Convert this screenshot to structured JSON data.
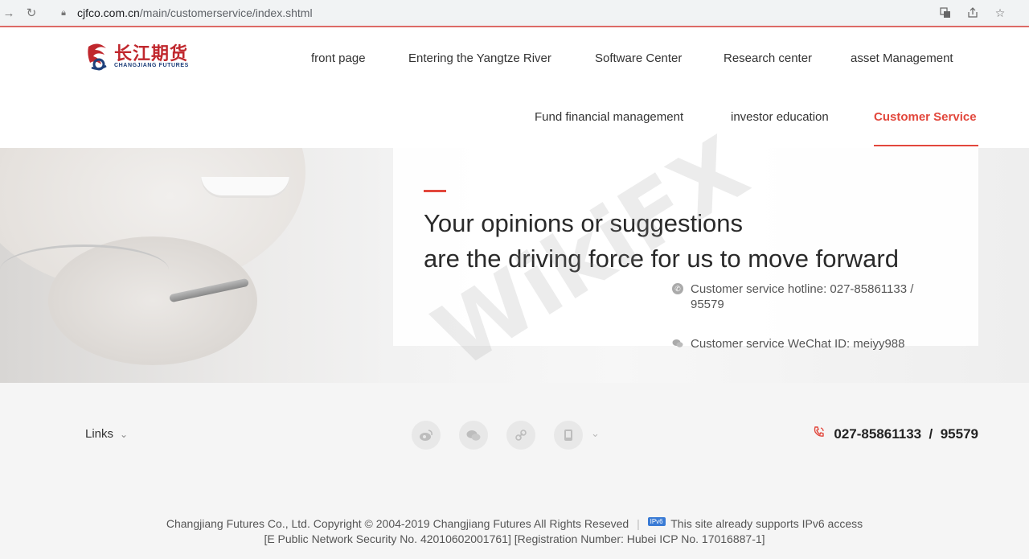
{
  "browser": {
    "url_host": "cjfco.com.cn",
    "url_path": "/main/customerservice/index.shtml"
  },
  "logo": {
    "cn": "长江期货",
    "en": "CHANGJIANG FUTURES"
  },
  "nav": {
    "row1": [
      "front page",
      "Entering the Yangtze River",
      "Software Center",
      "Research center",
      "asset Management"
    ],
    "row2": [
      "Fund financial management",
      "investor education",
      "Customer Service"
    ],
    "active": "Customer Service"
  },
  "hero": {
    "line1": "Your opinions or suggestions",
    "line2": "are the driving force for us to move forward",
    "hotline": "Customer service hotline: 027-85861133 / 95579",
    "wechat": "Customer service WeChat ID: meiyy988"
  },
  "footer": {
    "links_label": "Links",
    "phone": "027-85861133  /  95579",
    "copyright": "Changjiang Futures Co., Ltd. Copyright © 2004-2019 Changjiang Futures All Rights Reseved",
    "ipv6_badge": "IPv6",
    "ipv6_text": "This site already supports IPv6 access",
    "registration": "[E Public Network Security No. 42010602001761] [Registration Number: Hubei ICP No. 17016887-1]"
  },
  "colors": {
    "accent": "#e2473c",
    "logo_red": "#c0272d",
    "logo_blue": "#1e3f7a"
  }
}
